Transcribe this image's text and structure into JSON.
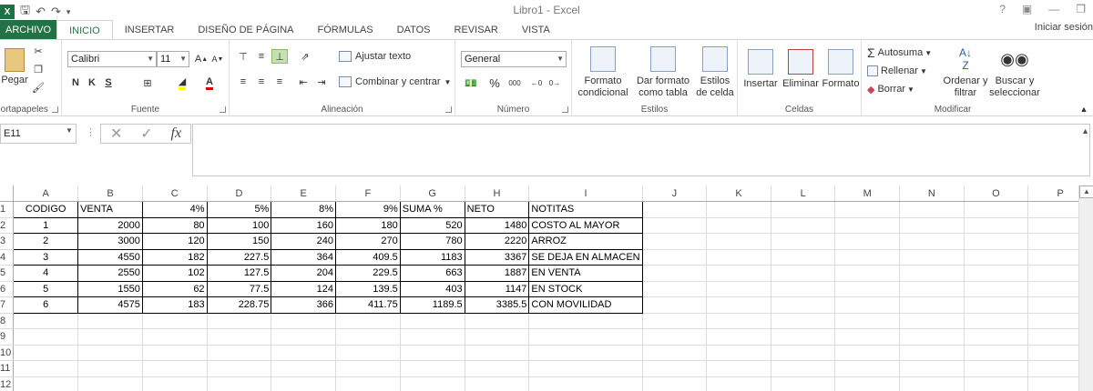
{
  "window": {
    "title": "Libro1 - Excel"
  },
  "ribbon_tabs": [
    {
      "label": "ARCHIVO"
    },
    {
      "label": "INICIO"
    },
    {
      "label": "INSERTAR"
    },
    {
      "label": "DISEÑO DE PÁGINA"
    },
    {
      "label": "FÓRMULAS"
    },
    {
      "label": "DATOS"
    },
    {
      "label": "REVISAR"
    },
    {
      "label": "VISTA"
    }
  ],
  "signin": "Iniciar sesión",
  "groups": {
    "clipboard": {
      "label": "Portapapeles",
      "paste": "Pegar"
    },
    "font": {
      "label": "Fuente",
      "font_name": "Calibri",
      "font_size": "11",
      "bold": "N",
      "italic": "K",
      "underline": "S"
    },
    "alignment": {
      "label": "Alineación",
      "wrap": "Ajustar texto",
      "merge": "Combinar y centrar"
    },
    "number": {
      "label": "Número",
      "format": "General",
      "percent": "%",
      "thousands": "000"
    },
    "styles": {
      "label": "Estilos",
      "conditional": "Formato condicional",
      "as_table": "Dar formato como tabla",
      "cell_styles": "Estilos de celda"
    },
    "cells": {
      "label": "Celdas",
      "insert": "Insertar",
      "delete": "Eliminar",
      "format": "Formato"
    },
    "edit": {
      "label": "Modificar",
      "autosum": "Autosuma",
      "fill": "Rellenar",
      "clear": "Borrar",
      "sort": "Ordenar y filtrar",
      "find": "Buscar y seleccionar"
    }
  },
  "formula_bar": {
    "name_box": "E11",
    "fx": "fx",
    "formula": ""
  },
  "sheet": {
    "columns": [
      "A",
      "B",
      "C",
      "D",
      "E",
      "F",
      "G",
      "H",
      "I",
      "J",
      "K",
      "L",
      "M",
      "N",
      "O",
      "P"
    ],
    "row_numbers": [
      "1",
      "2",
      "3",
      "4",
      "5",
      "6",
      "7",
      "8",
      "9",
      "10",
      "11",
      "12"
    ],
    "header_row": [
      "CODIGO",
      "VENTA",
      "4%",
      "5%",
      "8%",
      "9%",
      "SUMA %",
      "NETO",
      "NOTITAS"
    ],
    "rows": [
      [
        "1",
        "2000",
        "80",
        "100",
        "160",
        "180",
        "520",
        "1480",
        "COSTO AL MAYOR"
      ],
      [
        "2",
        "3000",
        "120",
        "150",
        "240",
        "270",
        "780",
        "2220",
        "ARROZ"
      ],
      [
        "3",
        "4550",
        "182",
        "227.5",
        "364",
        "409.5",
        "1183",
        "3367",
        "SE DEJA EN ALMACEN"
      ],
      [
        "4",
        "2550",
        "102",
        "127.5",
        "204",
        "229.5",
        "663",
        "1887",
        "EN VENTA"
      ],
      [
        "5",
        "1550",
        "62",
        "77.5",
        "124",
        "139.5",
        "403",
        "1147",
        "EN STOCK"
      ],
      [
        "6",
        "4575",
        "183",
        "228.75",
        "366",
        "411.75",
        "1189.5",
        "3385.5",
        "CON MOVILIDAD"
      ]
    ]
  }
}
